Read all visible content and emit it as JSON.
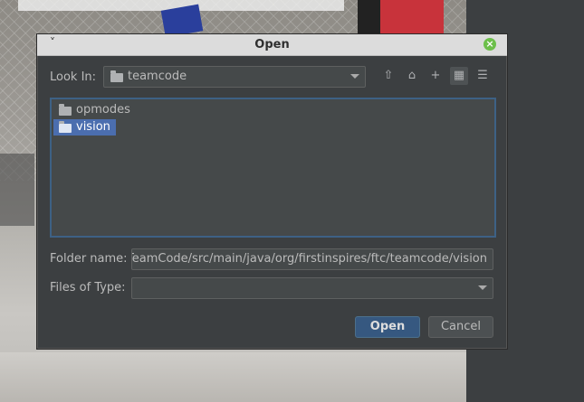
{
  "dialog": {
    "title": "Open",
    "menu_glyph": "˅",
    "close_glyph": "×"
  },
  "look_in": {
    "label": "Look In:",
    "value": "teamcode",
    "icon": "folder-icon"
  },
  "toolbar": {
    "up_icon": "folder-up-icon",
    "home_icon": "home-icon",
    "new_folder_icon": "new-folder-icon",
    "grid_icon": "grid-view-icon",
    "list_icon": "list-view-icon",
    "up_glyph": "⇧",
    "home_glyph": "⌂",
    "new_folder_glyph": "+",
    "grid_glyph": "▦",
    "list_glyph": "☰"
  },
  "files": [
    {
      "name": "opmodes",
      "selected": false
    },
    {
      "name": "vision",
      "selected": true
    }
  ],
  "folder_name": {
    "label": "Folder name:",
    "value": "troller/TeamCode/src/main/java/org/firstinspires/ftc/teamcode/vision"
  },
  "files_of_type": {
    "label": "Files of Type:",
    "value": ""
  },
  "buttons": {
    "open_label": "Open",
    "cancel_label": "Cancel"
  },
  "colors": {
    "dialog_bg": "#3c3f41",
    "selection": "#4b6eaf",
    "primary_button": "#365880"
  }
}
